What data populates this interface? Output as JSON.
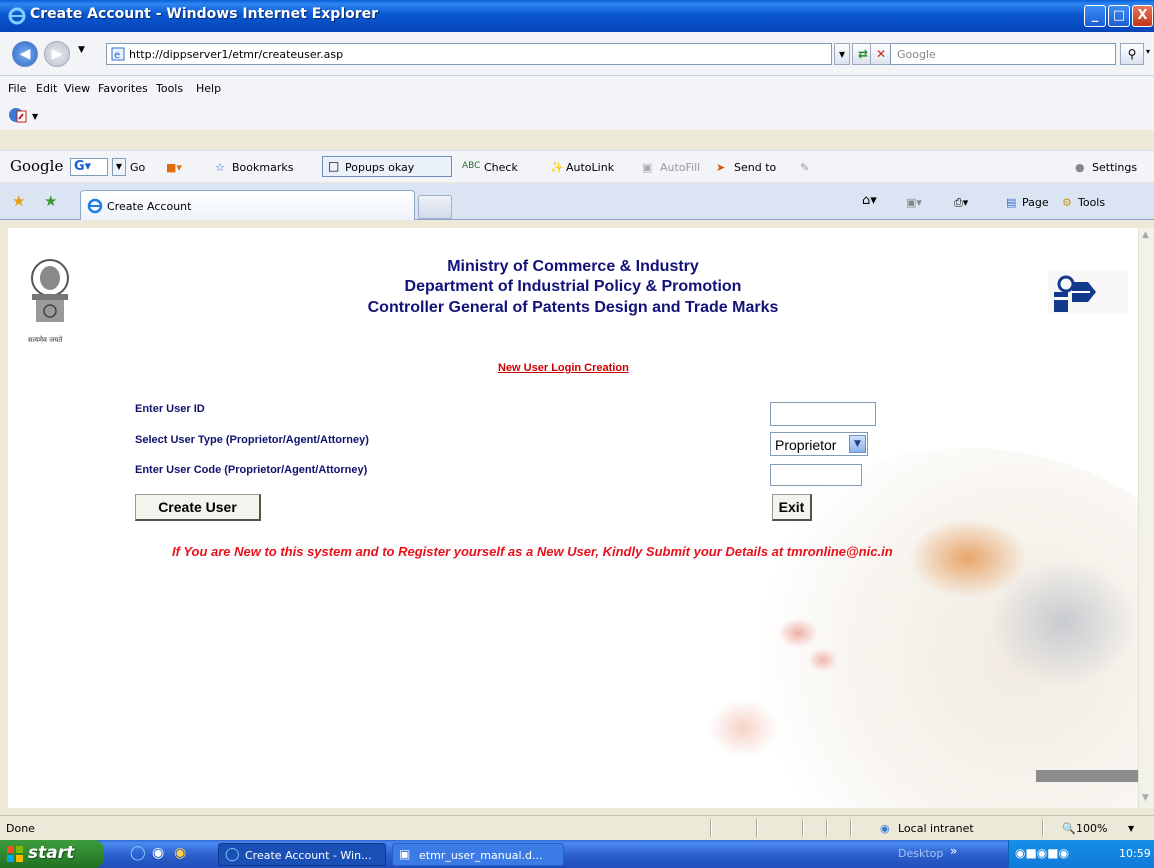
{
  "window": {
    "title": "Create Account - Windows Internet Explorer",
    "buttons": [
      "_",
      "□",
      "X"
    ]
  },
  "address_bar": {
    "url": "http://dippserver1/etmr/createuser.asp",
    "search_placeholder": "Google"
  },
  "menu": {
    "items": [
      "File",
      "Edit",
      "View",
      "Favorites",
      "Tools",
      "Help"
    ]
  },
  "google_toolbar": {
    "logo": "Google",
    "go": "Go",
    "bookmarks": "Bookmarks",
    "popups": "Popups okay",
    "check": "Check",
    "autolink": "AutoLink",
    "autofill": "AutoFill",
    "sendto": "Send to",
    "settings": "Settings"
  },
  "tabs": {
    "active_label": "Create Account",
    "page_menu": "Page",
    "tools_menu": "Tools"
  },
  "page": {
    "header_line1": "Ministry of Commerce & Industry",
    "header_line2": "Department of Industrial Policy & Promotion",
    "header_line3": "Controller General of Patents Design and Trade Marks",
    "emblem_caption": "सत्यमेव जयते",
    "section_link": "New User Login Creation",
    "label_user_id": "Enter User ID",
    "label_user_type": "Select User Type (Proprietor/Agent/Attorney)",
    "label_user_code": "Enter User Code (Proprietor/Agent/Attorney)",
    "user_type_selected": "Proprietor",
    "user_id_value": "",
    "user_code_value": "",
    "create_button": "Create User",
    "exit_button": "Exit",
    "notice": "If You are New to this system and to Register yourself as a New User, Kindly Submit your Details at tmronline@nic.in"
  },
  "status_bar": {
    "status": "Done",
    "zone": "Local intranet",
    "zoom": "100%"
  },
  "taskbar": {
    "start": "start",
    "tasks": [
      "Create Account - Win...",
      "etmr_user_manual.d..."
    ],
    "desktop": "Desktop",
    "clock": "10:59"
  },
  "colors": {
    "header_text": "#12127a",
    "label_text": "#11116e",
    "link_red": "#cc0000",
    "notice_red": "#e8111c",
    "titlebar_blue": "#0a5fd8"
  }
}
